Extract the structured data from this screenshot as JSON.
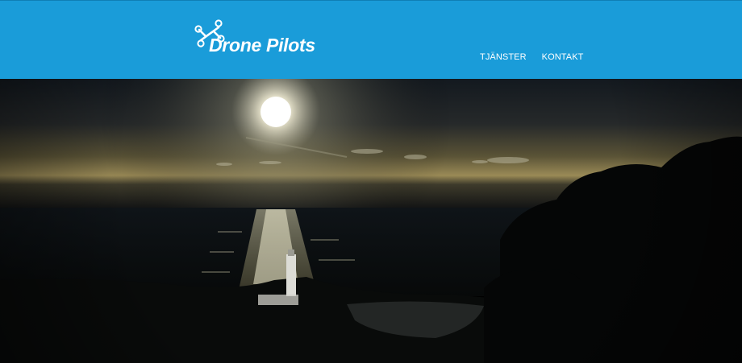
{
  "brand": {
    "name": "Drone Pilots",
    "icon": "drone-icon"
  },
  "nav": {
    "items": [
      {
        "label": "TJÄNSTER"
      },
      {
        "label": "KONTAKT"
      }
    ]
  },
  "hero": {
    "image": "sunset-over-sea-with-lighthouse"
  },
  "colors": {
    "header_bg": "#1a9cd9",
    "nav_text": "#ffffff"
  }
}
